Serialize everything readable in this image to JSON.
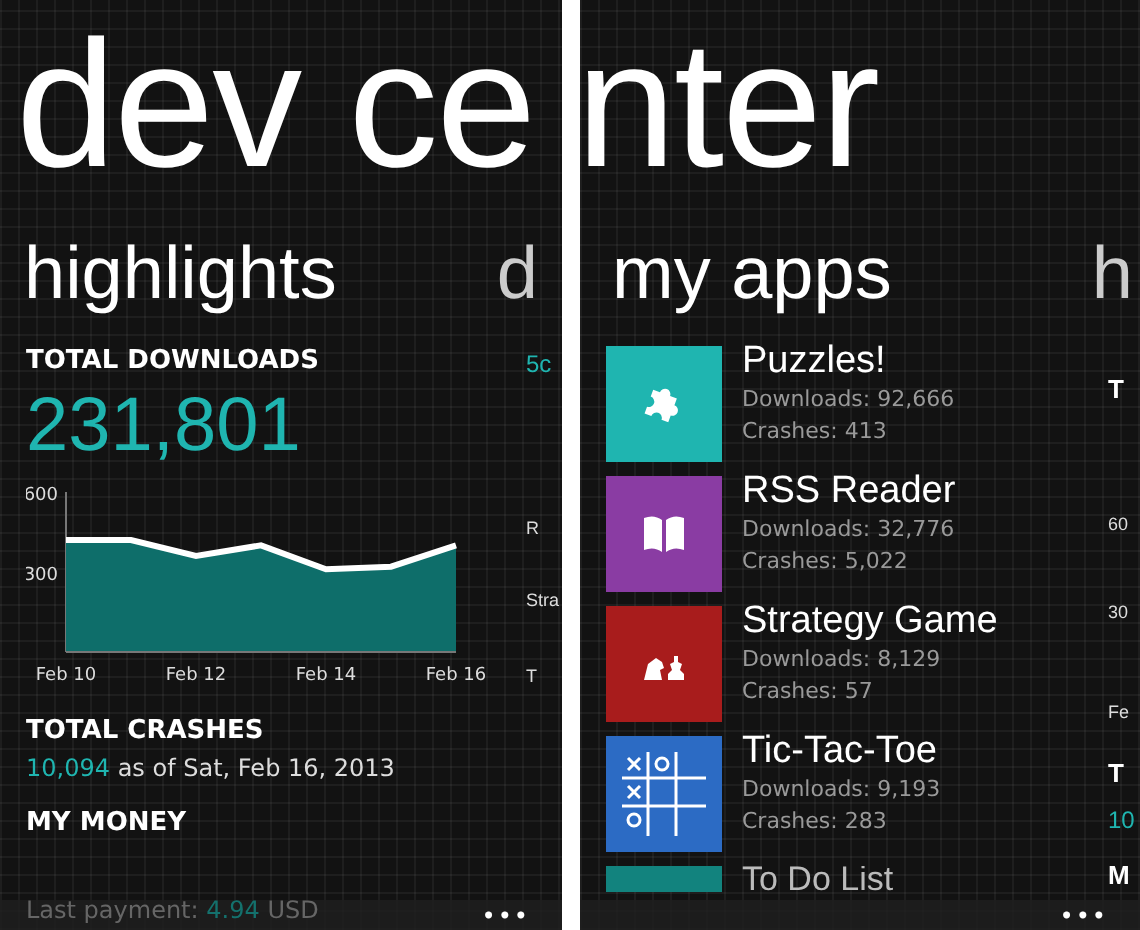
{
  "left_screen": {
    "title": "dev ce",
    "pivot_header": "highlights",
    "next_pivot_header": "d",
    "downloads": {
      "label": "TOTAL DOWNLOADS",
      "value": "231,801",
      "chart_data": {
        "type": "area",
        "categories": [
          "Feb 10",
          null,
          "Feb 12",
          null,
          "Feb 14",
          null,
          "Feb 16"
        ],
        "series": [
          {
            "color": "#0e6e6a",
            "values": [
              420,
              420,
              360,
              400,
              310,
              320,
              400
            ]
          }
        ],
        "yticks": [
          300,
          600
        ],
        "ylim": [
          0,
          600
        ]
      }
    },
    "crashes": {
      "label": "TOTAL CRASHES",
      "count": "10,094",
      "as_of": "as of Sat, Feb 16, 2013"
    },
    "money": {
      "label": "MY MONEY",
      "payment_label": "Last payment:",
      "amount": "4.94",
      "currency": "USD"
    },
    "peek_texts": [
      "5c",
      "R",
      "Stra",
      "T"
    ],
    "app_bar": {
      "more": "•••"
    }
  },
  "right_screen": {
    "title": "nter",
    "pivot_header": "my apps",
    "next_pivot_header": "h",
    "apps": [
      {
        "name": "Puzzles!",
        "downloads": "Downloads: 92,666",
        "crashes": "Crashes: 413",
        "color": "#1fb5b0",
        "kind": "puzzle"
      },
      {
        "name": "RSS Reader",
        "downloads": "Downloads: 32,776",
        "crashes": "Crashes: 5,022",
        "color": "#8a3ca3",
        "kind": "book"
      },
      {
        "name": "Strategy Game",
        "downloads": "Downloads: 8,129",
        "crashes": "Crashes: 57",
        "color": "#a81c1c",
        "kind": "pieces"
      },
      {
        "name": "Tic-Tac-Toe",
        "downloads": "Downloads: 9,193",
        "crashes": "Crashes: 283",
        "color": "#2c6bc4",
        "kind": "grid"
      },
      {
        "name": "To Do List",
        "color": "#12837e",
        "kind": "list"
      }
    ],
    "peek_texts": [
      "T",
      "60",
      "30",
      "Fe",
      "T",
      "10",
      "M"
    ],
    "app_bar": {
      "more": "•••"
    }
  }
}
